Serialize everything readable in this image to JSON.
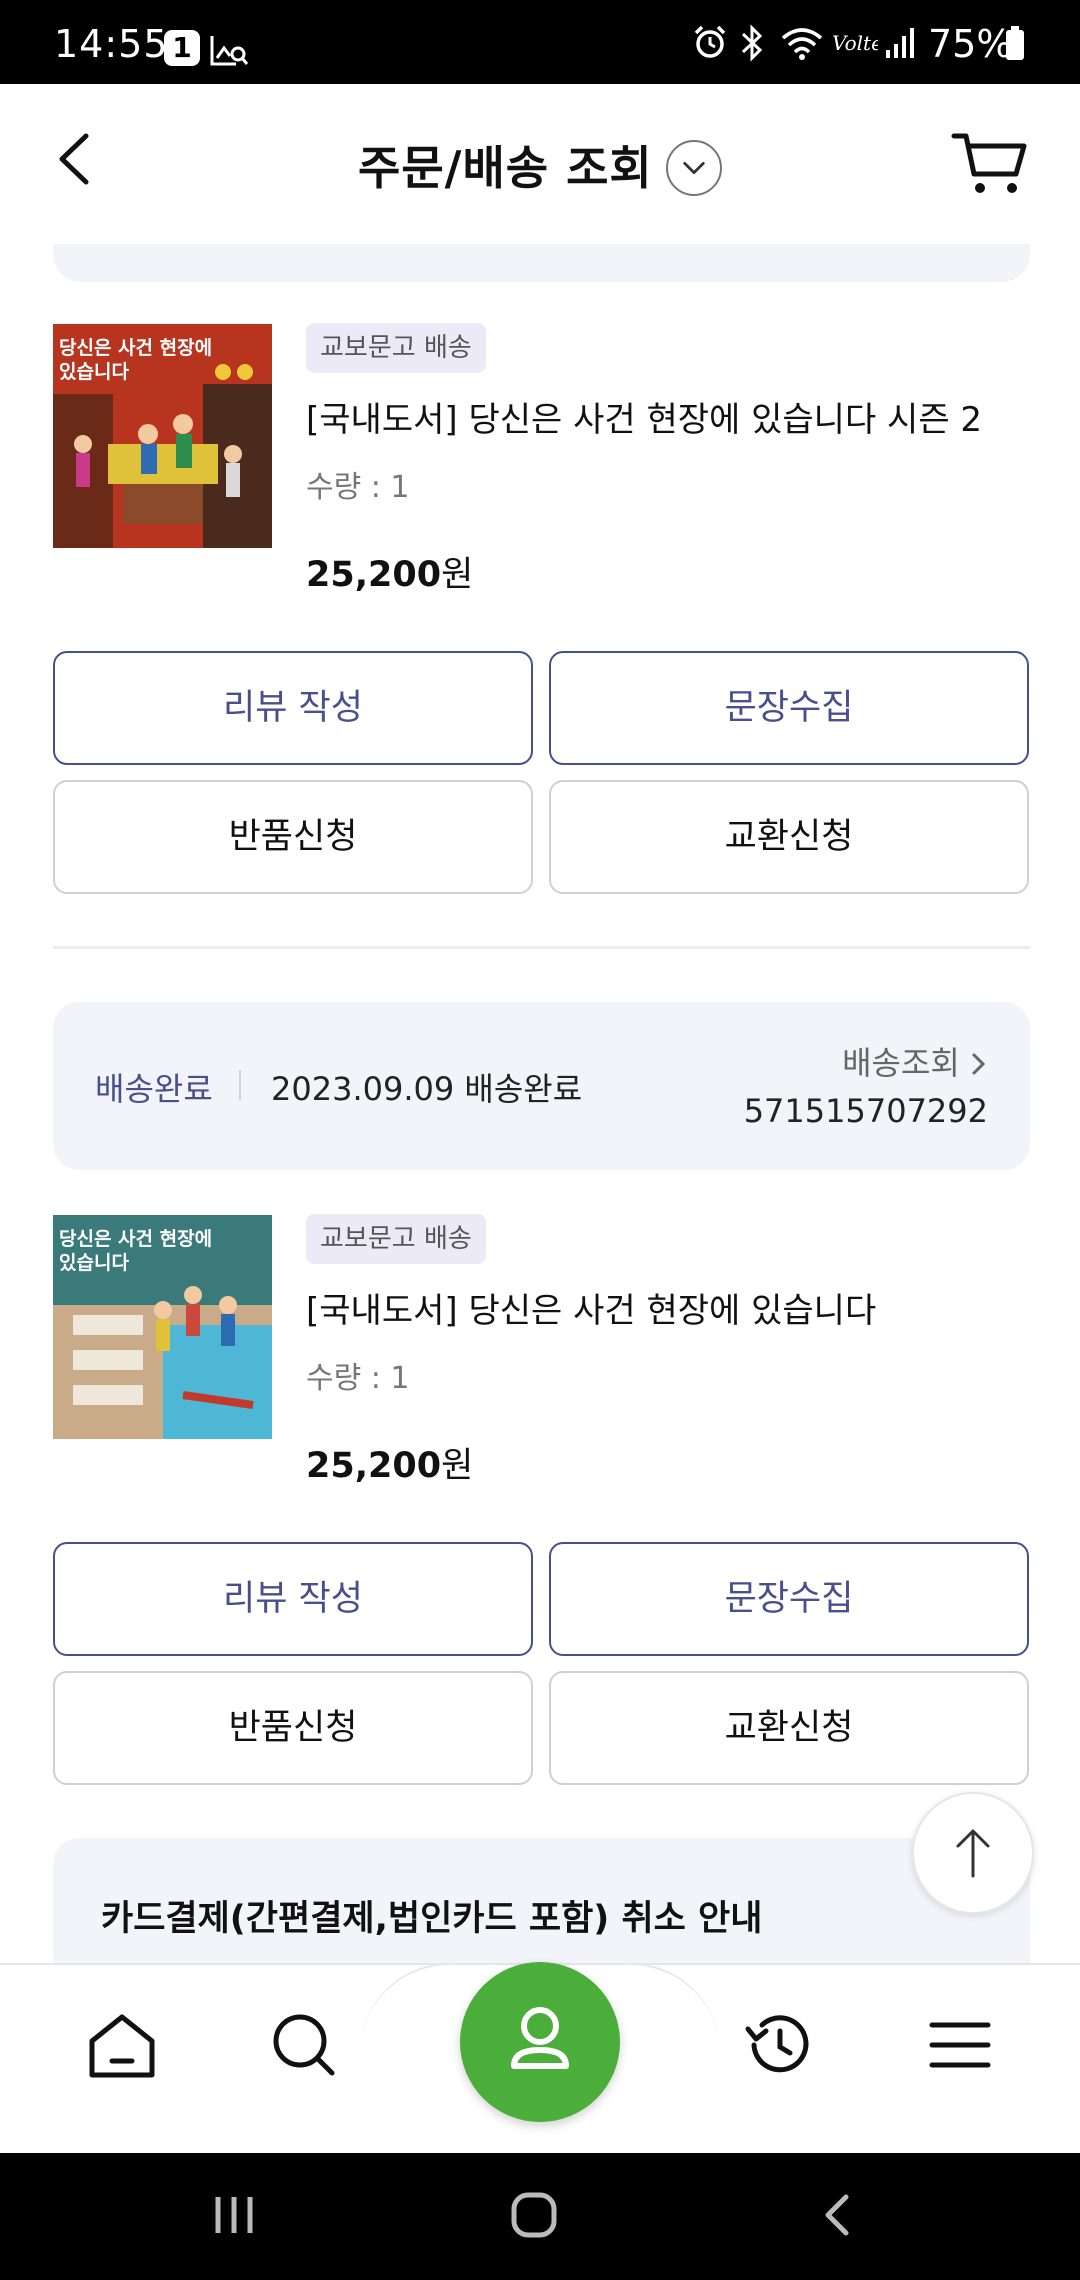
{
  "status_bar": {
    "time": "14:55",
    "notification_badge": "1",
    "battery": "75%"
  },
  "header": {
    "title": "주문/배송 조회"
  },
  "items": [
    {
      "badge": "교보문고 배송",
      "title": "[국내도서] 당신은 사건 현장에 있습니다 시즌 2",
      "qty": "수량 : 1",
      "price_number": "25,200",
      "price_unit": "원",
      "cover_title": "당신은 사건 현장에 있습니다",
      "buttons": {
        "review": "리뷰 작성",
        "sentence": "문장수집",
        "return": "반품신청",
        "exchange": "교환신청"
      }
    },
    {
      "badge": "교보문고 배송",
      "title": "[국내도서] 당신은 사건 현장에 있습니다",
      "qty": "수량 : 1",
      "price_number": "25,200",
      "price_unit": "원",
      "cover_title": "당신은 사건 현장에 있습니다",
      "buttons": {
        "review": "리뷰 작성",
        "sentence": "문장수집",
        "return": "반품신청",
        "exchange": "교환신청"
      }
    }
  ],
  "shipping": {
    "status": "배송완료",
    "date": "2023.09.09 배송완료",
    "track_label": "배송조회",
    "tracking_number": "571515707292"
  },
  "cancel_notice": {
    "title": "카드결제(간편결제,법인카드 포함) 취소 안내"
  },
  "bottom_nav": [
    "home-icon",
    "search-icon",
    "user-icon",
    "history-icon",
    "menu-icon"
  ],
  "colors": {
    "accent": "#474f8c",
    "badge_bg": "#eceaf7",
    "box_bg": "#f3f4fa",
    "nav_center": "#4bae3b"
  }
}
